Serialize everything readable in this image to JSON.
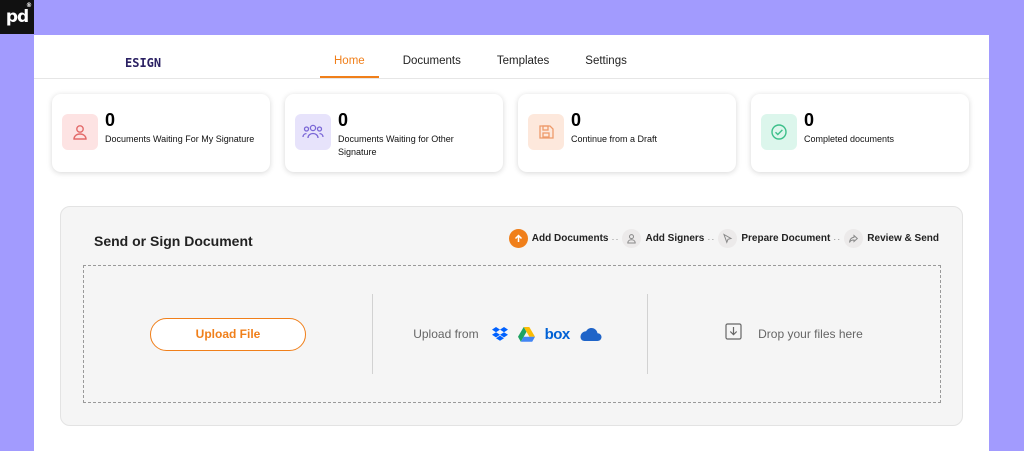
{
  "watermark": {
    "text": "pd",
    "mark": "®"
  },
  "brand": "ESIGN",
  "nav": {
    "tabs": [
      {
        "label": "Home",
        "active": true
      },
      {
        "label": "Documents"
      },
      {
        "label": "Templates"
      },
      {
        "label": "Settings"
      }
    ]
  },
  "cards": [
    {
      "count": "0",
      "label": "Documents Waiting For My Signature",
      "icon": "user-icon",
      "bg": "#fde3e3",
      "color": "#e36a6a"
    },
    {
      "count": "0",
      "label": "Documents Waiting for Other Signature",
      "icon": "users-icon",
      "bg": "#e7e3fb",
      "color": "#7a67d6"
    },
    {
      "count": "0",
      "label": "Continue from a Draft",
      "icon": "save-icon",
      "bg": "#fde8dc",
      "color": "#ee9a6a"
    },
    {
      "count": "0",
      "label": "Completed documents",
      "icon": "check-circle-icon",
      "bg": "#dcf6ec",
      "color": "#3cbf8a"
    }
  ],
  "panel": {
    "title": "Send or Sign Document",
    "steps": [
      {
        "label": "Add Documents",
        "icon": "upload-icon",
        "active": true
      },
      {
        "label": "Add Signers",
        "icon": "user-icon"
      },
      {
        "label": "Prepare Document",
        "icon": "cursor-icon"
      },
      {
        "label": "Review & Send",
        "icon": "share-icon"
      }
    ],
    "upload_button": "Upload File",
    "upload_from": "Upload from",
    "services": [
      "dropbox-icon",
      "google-drive-icon",
      "box-icon",
      "onedrive-icon"
    ],
    "box_text": "box",
    "drop_text": "Drop your files here"
  },
  "colors": {
    "accent": "#f07f1a",
    "background": "#a29bfe"
  }
}
